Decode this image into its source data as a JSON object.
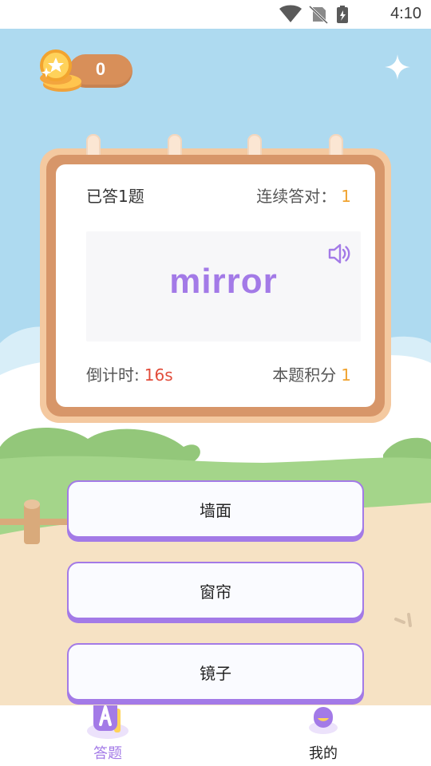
{
  "status_bar": {
    "time": "4:10",
    "icons": [
      "wifi-icon",
      "no-sim-icon",
      "battery-icon"
    ]
  },
  "coins": {
    "count": "0"
  },
  "quiz": {
    "answered": "已答1题",
    "streak_label": "连续答对：",
    "streak_value": "1",
    "word": "mirror",
    "countdown_label": "倒计时:",
    "countdown_value": "16s",
    "score_label": "本题积分",
    "score_value": "1"
  },
  "options": [
    "墙面",
    "窗帘",
    "镜子"
  ],
  "tabs": [
    {
      "label": "答题",
      "icon": "quiz-icon",
      "active": true
    },
    {
      "label": "我的",
      "icon": "profile-icon",
      "active": false
    }
  ],
  "colors": {
    "accent": "#a37ae7",
    "sky": "#aedaf0",
    "card_frame": "#d79669",
    "streak": "#f0a32f",
    "countdown": "#e24d3b",
    "grass": "#a4d58a",
    "ground": "#f6e2c4"
  }
}
